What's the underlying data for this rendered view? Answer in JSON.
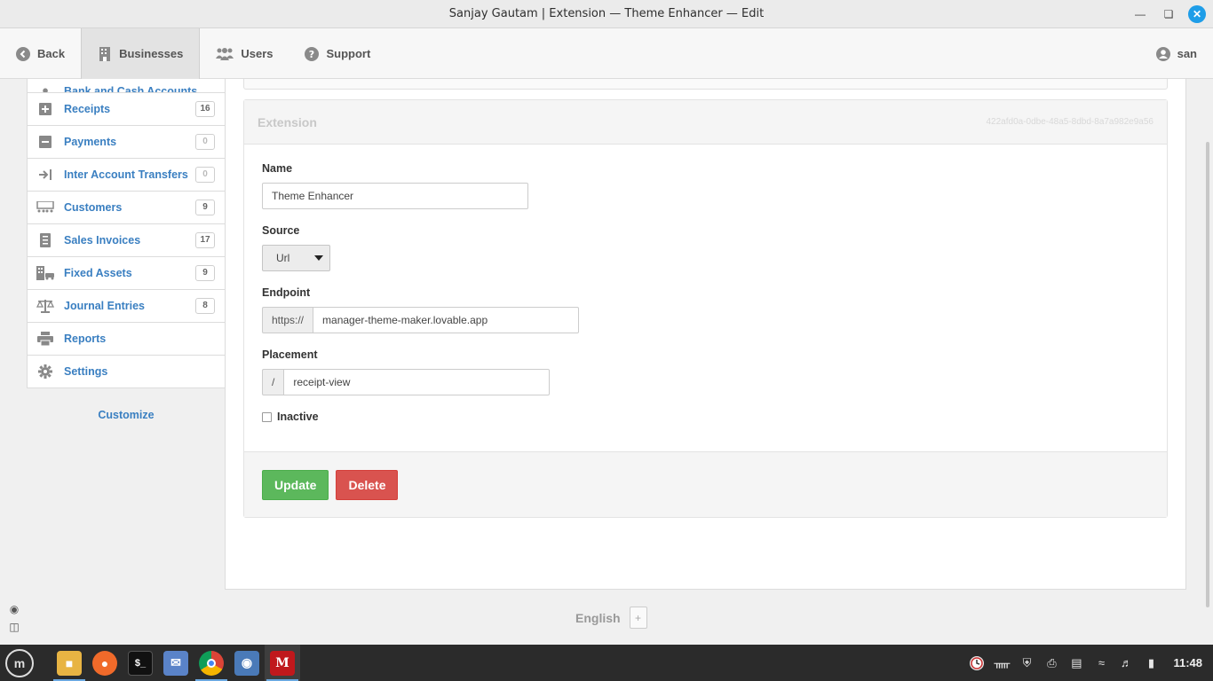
{
  "window": {
    "title": "Sanjay Gautam | Extension — Theme Enhancer — Edit"
  },
  "topnav": {
    "back": "Back",
    "businesses": "Businesses",
    "users": "Users",
    "support": "Support",
    "user": "san"
  },
  "sidebar": {
    "partial_item": "Bank and Cash Accounts",
    "items": [
      {
        "label": "Receipts",
        "badge": "16",
        "icon": "plus-square-icon"
      },
      {
        "label": "Payments",
        "badge": "0",
        "icon": "minus-square-icon"
      },
      {
        "label": "Inter Account Transfers",
        "badge": "0",
        "icon": "transfer-arrow-icon"
      },
      {
        "label": "Customers",
        "badge": "9",
        "icon": "customers-icon"
      },
      {
        "label": "Sales Invoices",
        "badge": "17",
        "icon": "invoice-icon"
      },
      {
        "label": "Fixed Assets",
        "badge": "9",
        "icon": "building-icon"
      },
      {
        "label": "Journal Entries",
        "badge": "8",
        "icon": "balance-scale-icon"
      },
      {
        "label": "Reports",
        "badge": "",
        "icon": "printer-icon"
      },
      {
        "label": "Settings",
        "badge": "",
        "icon": "gear-icon"
      }
    ],
    "customize": "Customize"
  },
  "panel": {
    "title": "Extension",
    "id": "422afd0a-0dbe-48a5-8dbd-8a7a982e9a56",
    "name_label": "Name",
    "name_value": "Theme Enhancer",
    "source_label": "Source",
    "source_value": "Url",
    "endpoint_label": "Endpoint",
    "endpoint_prefix": "https://",
    "endpoint_value": "manager-theme-maker.lovable.app",
    "placement_label": "Placement",
    "placement_prefix": "/",
    "placement_value": "receipt-view",
    "inactive_label": "Inactive",
    "inactive_checked": false,
    "update_label": "Update",
    "delete_label": "Delete"
  },
  "footer": {
    "language": "English",
    "add": "+"
  },
  "taskbar": {
    "clock": "11:48",
    "apps": [
      "files-icon",
      "firefox-icon",
      "terminal-icon",
      "mail-icon",
      "chrome-icon",
      "screenshot-icon",
      "manager-icon"
    ]
  },
  "colors": {
    "accent": "#3a7fc1",
    "update": "#5cb85c",
    "delete": "#d9534f",
    "close": "#1e9de8"
  }
}
